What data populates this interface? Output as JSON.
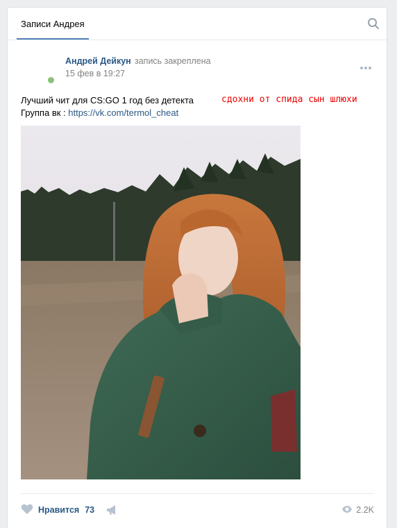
{
  "tabs": {
    "active_label": "Записи Андрея"
  },
  "post": {
    "author": "Андрей Дейкун",
    "pin_note": "запись закреплена",
    "date": "15 фев в 19:27",
    "text_line1": "Лучший чит для CS:GO 1 год без детекта",
    "overlay_text": "сдохни от спида сын шлюхи",
    "text_line2_prefix": "Группа вк : ",
    "link": "https://vk.com/termol_cheat"
  },
  "footer": {
    "like_label": "Нравится",
    "like_count": "73",
    "views_count": "2.2K"
  },
  "colors": {
    "accent": "#2a5885",
    "online": "#8ac176",
    "overlay_red": "#e00000",
    "muted": "#828282"
  },
  "icons": [
    "search-icon",
    "more-icon",
    "heart-icon",
    "megaphone-icon",
    "eye-icon"
  ]
}
